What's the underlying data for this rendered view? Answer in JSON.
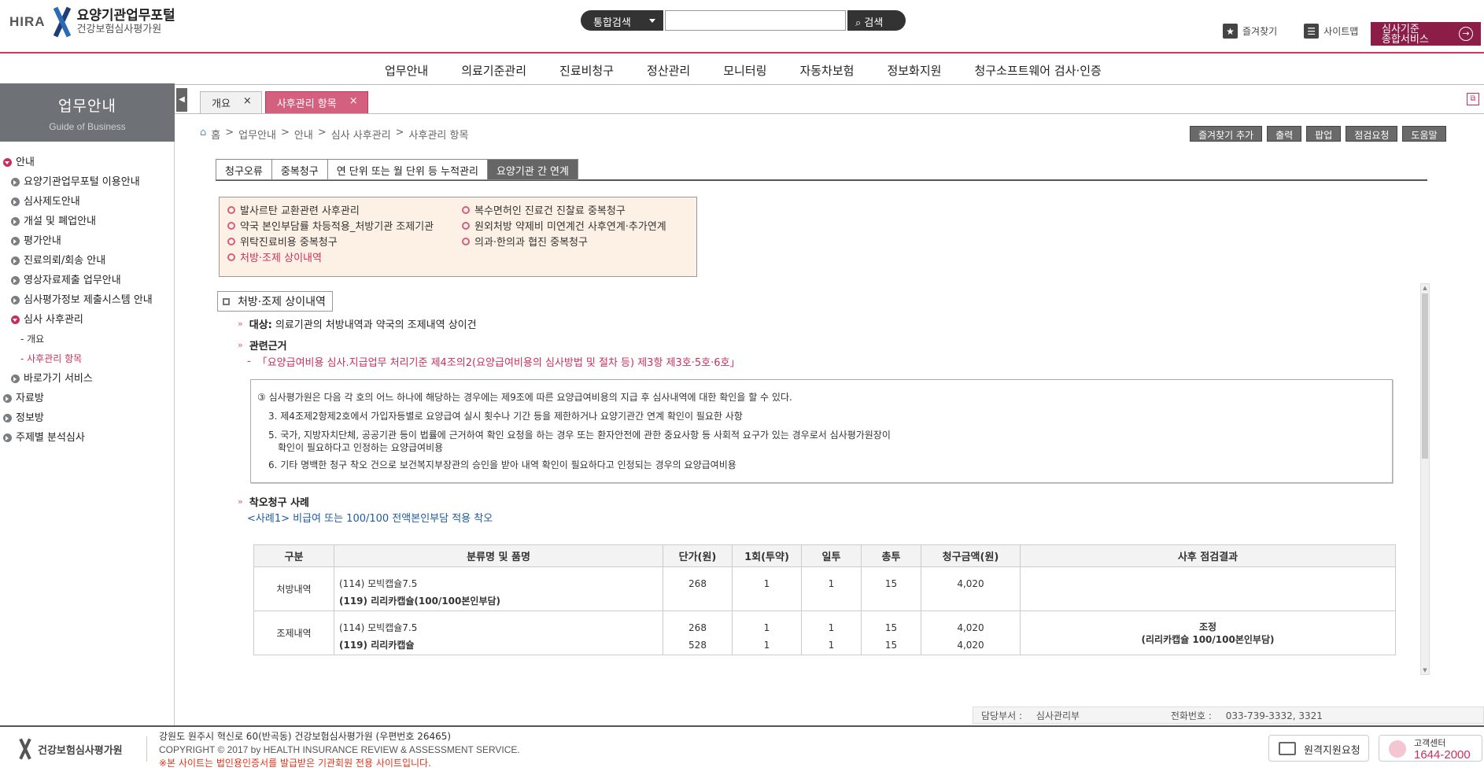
{
  "header": {
    "logo_brand": "HIRA",
    "logo_title": "요양기관업무포털",
    "logo_sub": "건강보험심사평가원",
    "search_select": "통합검색",
    "search_value": "",
    "search_button": "검색",
    "bookmark": "즐겨찾기",
    "sitemap": "사이트맵",
    "service_line1": "심사기준",
    "service_line2": "종합서비스"
  },
  "gnb": [
    "업무안내",
    "의료기준관리",
    "진료비청구",
    "정산관리",
    "모니터링",
    "자동차보험",
    "정보화지원",
    "청구소프트웨어 검사·인증"
  ],
  "sidebar": {
    "title": "업무안내",
    "subtitle": "Guide of Business",
    "items": [
      {
        "label": "안내",
        "level": 1,
        "open": true
      },
      {
        "label": "요양기관업무포털 이용안내",
        "level": 2
      },
      {
        "label": "심사제도안내",
        "level": 2
      },
      {
        "label": "개설 및 폐업안내",
        "level": 2
      },
      {
        "label": "평가안내",
        "level": 2
      },
      {
        "label": "진료의뢰/회송 안내",
        "level": 2
      },
      {
        "label": "영상자료제출 업무안내",
        "level": 2
      },
      {
        "label": "심사평가정보 제출시스템 안내",
        "level": 2
      },
      {
        "label": "심사 사후관리",
        "level": 2,
        "open": true
      },
      {
        "label": "- 개요",
        "level": 3
      },
      {
        "label": "- 사후관리 항목",
        "level": 3,
        "active": true
      },
      {
        "label": "바로가기 서비스",
        "level": 2
      },
      {
        "label": "자료방",
        "level": 1
      },
      {
        "label": "정보방",
        "level": 1
      },
      {
        "label": "주제별 분석심사",
        "level": 1
      }
    ]
  },
  "tabs": [
    {
      "label": "개요",
      "close": "×"
    },
    {
      "label": "사후관리 항목",
      "close": "×"
    }
  ],
  "breadcrumb": [
    "홈",
    ">",
    "업무안내",
    ">",
    "안내",
    ">",
    "심사 사후관리",
    ">",
    "사후관리 항목"
  ],
  "actions": [
    "즐겨찾기 추가",
    "출력",
    "팝업",
    "점검요청",
    "도움말"
  ],
  "subtabs": [
    "청구오류",
    "중복청구",
    "연 단위 또는 월 단위 등 누적관리",
    "요양기관 간 연계"
  ],
  "topbox": {
    "left": [
      "발사르탄 교환관련 사후관리",
      "약국 본인부담률 차등적용_처방기관 조제기관",
      "위탁진료비용 중복청구",
      "처방·조제 상이내역"
    ],
    "right": [
      "복수면허인 진료건 진찰료 중복청구",
      "원외처방 약제비 미연계건 사후연계·추가연계",
      "의과·한의과 협진 중복청구"
    ]
  },
  "content": {
    "title": "처방·조제 상이내역",
    "target_label": "대상:",
    "target_text": "의료기관의 처방내역과 약국의 조제내역 상이건",
    "basis_label": "관련근거",
    "basis_dash": "-",
    "basis_ref": "「요양급여비용 심사.지급업무 처리기준 제4조의2(요양급여비용의 심사방법 및 절차 등) 제3항 제3호·5호·6호」",
    "law": [
      "③ 심사평가원은 다음 각 호의 어느 하나에 해당하는 경우에는 제9조에 따른 요양급여비용의 지급 후 심사내역에 대한 확인을 할 수 있다.",
      "3. 제4조제2항제2호에서 가입자등별로 요양급여 실시 횟수나 기간 등을 제한하거나 요양기관간 연계 확인이 필요한 사항",
      "5. 국가, 지방자치단체, 공공기관 등이 법률에 근거하여 확인 요청을 하는 경우 또는 환자안전에 관한 중요사항 등 사회적 요구가 있는 경우로서 심사평가원장이",
      "확인이 필요하다고 인정하는 요양급여비용",
      "6. 기타 명백한 청구 착오 건으로 보건복지부장관의 승인을 받아 내역 확인이 필요하다고 인정되는 경우의 요양급여비용"
    ],
    "case_label": "착오청구 사례",
    "case_title": "<사례1> 비급여 또는 100/100 전액본인부담 적용 착오",
    "table_headers": [
      "구분",
      "분류명 및 품명",
      "단가(원)",
      "1회(투약)",
      "일투",
      "총투",
      "청구금액(원)",
      "사후 점검결과"
    ],
    "rows": [
      {
        "kind": "처방내역",
        "items": [
          "(114) 모빅캡슐7.5",
          "(119) 리리카캡슐(100/100본인부담)"
        ],
        "price": [
          "268",
          ""
        ],
        "once": [
          "1",
          ""
        ],
        "daily": [
          "1",
          ""
        ],
        "total": [
          "15",
          ""
        ],
        "amount": [
          "4,020",
          ""
        ],
        "result1": "",
        "result2": ""
      },
      {
        "kind": "조제내역",
        "items": [
          "(114) 모빅캡슐7.5",
          "(119) 리리카캡슐"
        ],
        "price": [
          "268",
          "528"
        ],
        "once": [
          "1",
          "1"
        ],
        "daily": [
          "1",
          "1"
        ],
        "total": [
          "15",
          "15"
        ],
        "amount": [
          "4,020",
          "4,020"
        ],
        "result1": "조정",
        "result2": "(리리카캡슐 100/100본인부담)"
      }
    ]
  },
  "dept": {
    "label": "담당부서 :",
    "value": "심사관리부",
    "phone_label": "전화번호 :",
    "phone": "033-739-3332, 3321"
  },
  "footer": {
    "logo": "건강보험심사평가원",
    "address": "강원도 원주시 혁신로 60(반곡동) 건강보험심사평가원 (우편번호 26465)",
    "copyright": "COPYRIGHT © 2017 by HEALTH INSURANCE REVIEW & ASSESSMENT SERVICE.",
    "notice": "※본 사이트는 법인용인증서를 발급받은 기관회원 전용 사이트입니다.",
    "remote": "원격지원요청",
    "center_label": "고객센터",
    "center_phone": "1644-2000"
  }
}
